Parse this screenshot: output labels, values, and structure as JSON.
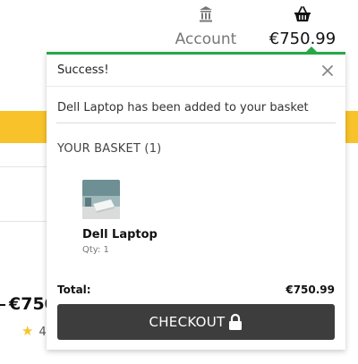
{
  "header": {
    "account_label": "Account",
    "basket_total": "€750.99",
    "account_icon": "building-icon",
    "basket_icon": "shopping-basket-icon"
  },
  "background": {
    "price_partial": "€750",
    "rating_partial": "4"
  },
  "toast": {
    "title": "Success!",
    "message": "Dell Laptop has been added to your basket",
    "basket_heading": "YOUR BASKET (1)",
    "item": {
      "name": "Dell Laptop",
      "qty": "Qty: 1"
    },
    "total_label": "Total:",
    "total_value": "€750.99",
    "checkout_label": "CHECKOUT"
  },
  "colors": {
    "success_accent": "#28a745",
    "brand_yellow": "#f8c32a",
    "checkout_bg": "#3d3d3d"
  }
}
